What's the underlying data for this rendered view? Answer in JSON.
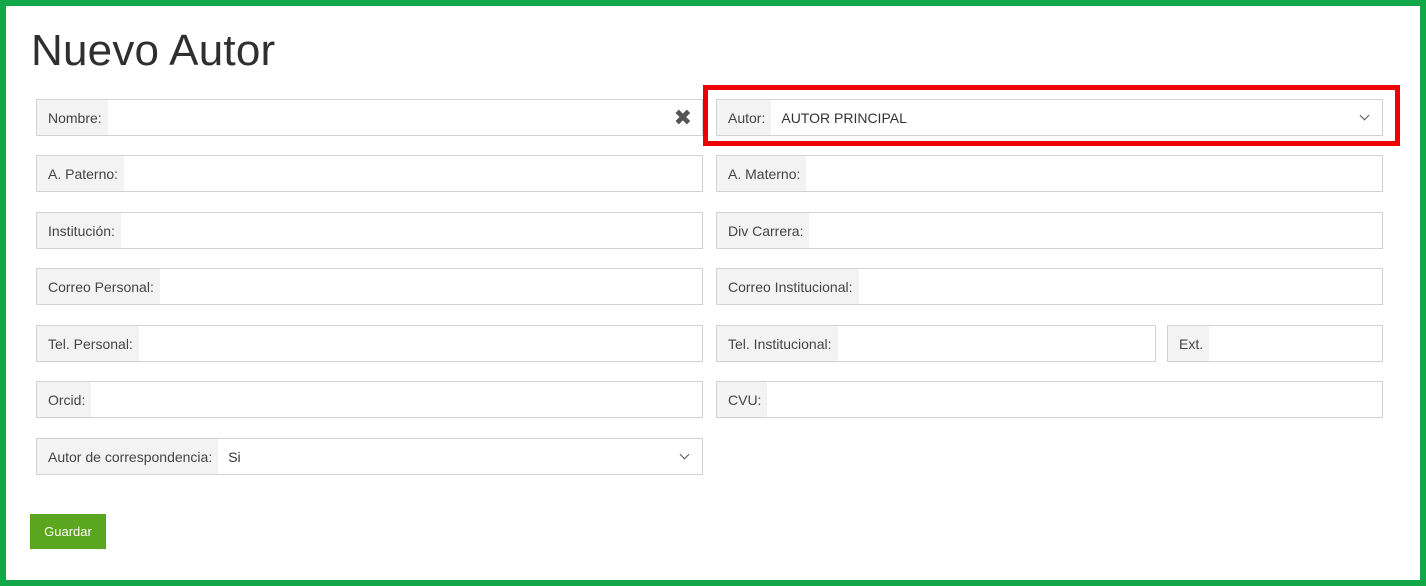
{
  "page": {
    "title": "Nuevo Autor"
  },
  "colors": {
    "frame_border": "#12a84a",
    "highlight_border": "#ee0000",
    "save_button": "#5aa61e"
  },
  "form": {
    "nombre": {
      "label": "Nombre:",
      "value": ""
    },
    "autor": {
      "label": "Autor:",
      "value": "AUTOR PRINCIPAL"
    },
    "a_paterno": {
      "label": "A. Paterno:",
      "value": ""
    },
    "a_materno": {
      "label": "A. Materno:",
      "value": ""
    },
    "institucion": {
      "label": "Institución:",
      "value": ""
    },
    "div_carrera": {
      "label": "Div Carrera:",
      "value": ""
    },
    "correo_personal": {
      "label": "Correo Personal:",
      "value": ""
    },
    "correo_institucional": {
      "label": "Correo Institucional:",
      "value": ""
    },
    "tel_personal": {
      "label": "Tel. Personal:",
      "value": ""
    },
    "tel_institucional": {
      "label": "Tel. Institucional:",
      "value": ""
    },
    "ext": {
      "label": "Ext.",
      "value": ""
    },
    "orcid": {
      "label": "Orcid:",
      "value": ""
    },
    "cvu": {
      "label": "CVU:",
      "value": ""
    },
    "autor_correspondencia": {
      "label": "Autor de correspondencia:",
      "value": "Si"
    }
  },
  "icons": {
    "clear": "close-x-icon",
    "dropdown": "chevron-down-icon"
  },
  "actions": {
    "save_label": "Guardar"
  }
}
